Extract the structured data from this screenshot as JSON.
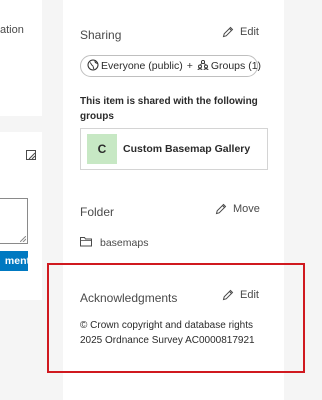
{
  "left": {
    "top_text": "ation",
    "comment_button": "ment"
  },
  "sharing": {
    "title": "Sharing",
    "edit_label": "Edit",
    "everyone_label": "Everyone (public)",
    "plus": "+",
    "groups_label": "Groups (1)",
    "shared_text": "This item is shared with the following groups",
    "group": {
      "initial": "C",
      "name": "Custom Basemap Gallery"
    }
  },
  "folder": {
    "title": "Folder",
    "move_label": "Move",
    "name": "basemaps"
  },
  "acknowledgments": {
    "title": "Acknowledgments",
    "edit_label": "Edit",
    "text": "© Crown copyright and database rights 2025 Ordnance Survey AC0000817921"
  },
  "colors": {
    "accent": "#0079c1",
    "highlight": "#d0191f",
    "group_avatar": "#c7e8c4"
  }
}
